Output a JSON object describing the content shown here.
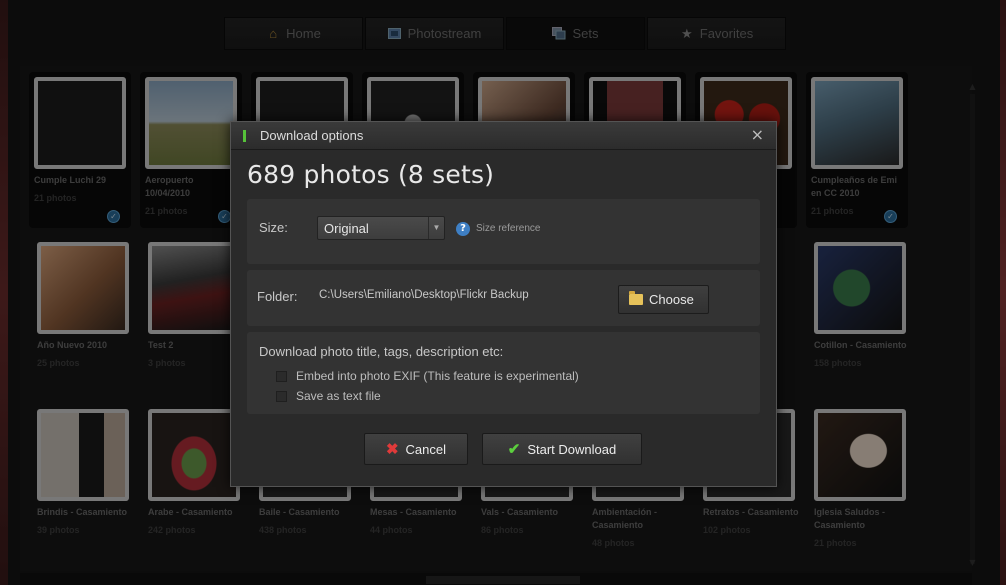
{
  "nav": {
    "tabs": [
      {
        "label": "Home",
        "icon": "home-icon"
      },
      {
        "label": "Photostream",
        "icon": "photostream-icon"
      },
      {
        "label": "Sets",
        "icon": "sets-icon",
        "active": true
      },
      {
        "label": "Favorites",
        "icon": "star-icon"
      }
    ]
  },
  "sets": [
    {
      "title": "Cumple Luchi 29",
      "count": "21 photos",
      "selected": true
    },
    {
      "title": "Aeropuerto 10/04/2010",
      "count": "21 photos",
      "selected": true
    },
    {
      "title": "",
      "count": ""
    },
    {
      "title": "",
      "count": ""
    },
    {
      "title": "",
      "count": ""
    },
    {
      "title": "",
      "count": ""
    },
    {
      "title": "",
      "count": ""
    },
    {
      "title": "Cumpleaños de Emi en CC 2010",
      "count": "21 photos",
      "selected": true
    },
    {
      "title": "Año Nuevo 2010",
      "count": "25 photos"
    },
    {
      "title": "Test 2",
      "count": "3 photos"
    },
    {
      "title": "Cotillon - Casamiento",
      "count": "158 photos"
    },
    {
      "title": "Brindis - Casamiento",
      "count": "39 photos"
    },
    {
      "title": "Arabe - Casamiento",
      "count": "242 photos"
    },
    {
      "title": "Baile - Casamiento",
      "count": "438 photos"
    },
    {
      "title": "Mesas - Casamiento",
      "count": "44 photos"
    },
    {
      "title": "Vals - Casamiento",
      "count": "86 photos"
    },
    {
      "title": "Ambientación - Casamiento",
      "count": "48 photos"
    },
    {
      "title": "Retratos - Casamiento",
      "count": "102 photos"
    },
    {
      "title": "Iglesia Saludos - Casamiento",
      "count": "21 photos"
    }
  ],
  "dialog": {
    "title": "Download options",
    "close": "×",
    "heading": "689 photos (8 sets)",
    "size": {
      "label": "Size:",
      "value": "Original",
      "help_icon": "help-icon",
      "help_label": "Size reference"
    },
    "folder": {
      "label": "Folder:",
      "path": "C:\\Users\\Emiliano\\Desktop\\Flickr Backup",
      "choose_label": "Choose"
    },
    "meta": {
      "title": "Download photo title, tags, description etc:",
      "options": [
        {
          "label": "Embed into photo EXIF (This feature is experimental)",
          "checked": false
        },
        {
          "label": "Save as text file",
          "checked": false
        }
      ]
    },
    "cancel_label": "Cancel",
    "start_label": "Start Download"
  },
  "colors": {
    "accent_green": "#56c23a",
    "cancel_red": "#e03a3a",
    "check_blue": "#2a6c9a"
  }
}
